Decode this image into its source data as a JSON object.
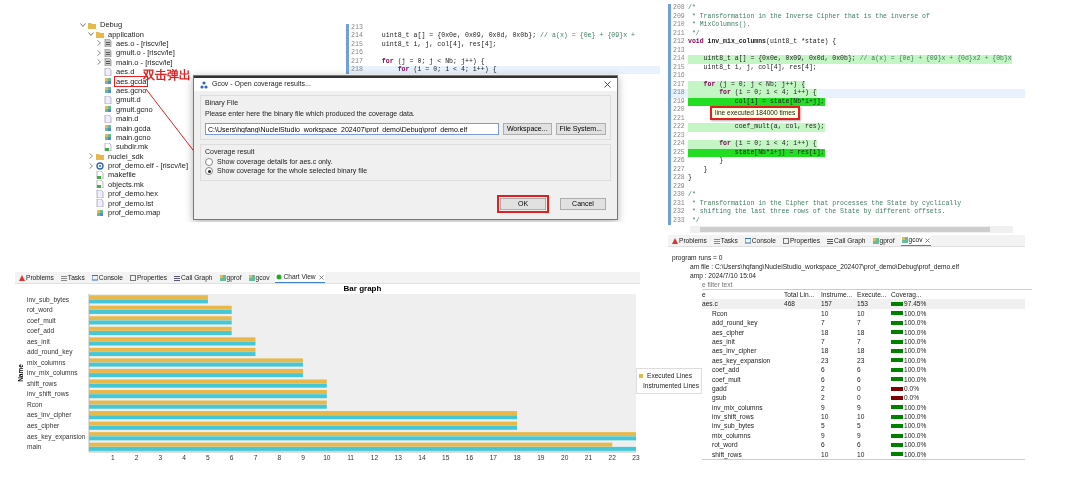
{
  "project_tree": {
    "items": [
      {
        "label": "Debug",
        "kind": "folder",
        "expanded": true,
        "highlighted": false,
        "children": [
          {
            "label": "application",
            "kind": "folder",
            "expanded": true,
            "highlighted": false,
            "children": [
              {
                "label": "aes.o - [riscv/le]",
                "kind": "object",
                "expanded": false,
                "highlighted": false
              },
              {
                "label": "gmult.o - [riscv/le]",
                "kind": "object",
                "expanded": false,
                "highlighted": false
              },
              {
                "label": "main.o - [riscv/le]",
                "kind": "object",
                "expanded": false,
                "highlighted": false
              },
              {
                "label": "aes.d",
                "kind": "file",
                "highlighted": false
              },
              {
                "label": "aes.gcda",
                "kind": "gcov",
                "highlighted": true
              },
              {
                "label": "aes.gcno",
                "kind": "gcov",
                "highlighted": false
              },
              {
                "label": "gmult.d",
                "kind": "file",
                "highlighted": false
              },
              {
                "label": "gmult.gcno",
                "kind": "gcov",
                "highlighted": false
              },
              {
                "label": "main.d",
                "kind": "file",
                "highlighted": false
              },
              {
                "label": "main.gcda",
                "kind": "gcov",
                "highlighted": false
              },
              {
                "label": "main.gcno",
                "kind": "gcov",
                "highlighted": false
              },
              {
                "label": "subdir.mk",
                "kind": "make",
                "highlighted": false
              }
            ]
          },
          {
            "label": "nuclei_sdk",
            "kind": "folder",
            "expanded": false,
            "highlighted": false
          },
          {
            "label": "prof_demo.elf - [riscv/le]",
            "kind": "elf",
            "expanded": false,
            "highlighted": false
          },
          {
            "label": "makefile",
            "kind": "make",
            "highlighted": false
          },
          {
            "label": "objects.mk",
            "kind": "make",
            "highlighted": false
          },
          {
            "label": "prof_demo.hex",
            "kind": "file",
            "highlighted": false
          },
          {
            "label": "prof_demo.lst",
            "kind": "file",
            "highlighted": false
          },
          {
            "label": "prof_demo.map",
            "kind": "gcov",
            "highlighted": false
          }
        ]
      }
    ]
  },
  "annotation": {
    "text": "双击弹出"
  },
  "back_editor": {
    "lines": [
      {
        "number": "213",
        "current": false
      },
      {
        "number": "214",
        "code": "    uint8_t a[] = {0x0e, 0x09, 0x0d, 0x0b}; // a(x) = {0e} + {09}x +",
        "kind": "code",
        "current": false
      },
      {
        "number": "215",
        "code": "    uint8_t i, j, col[4], res[4];",
        "kind": "code",
        "current": false
      },
      {
        "number": "216",
        "current": false
      },
      {
        "number": "217",
        "code": "    for (j = 0; j < Nb; j++) {",
        "kind": "code",
        "current": false
      },
      {
        "number": "218",
        "code": "        for (i = 0; i < 4; i++) {",
        "kind": "code",
        "current": true
      }
    ]
  },
  "dialog": {
    "title": "Gcov - Open coverage results...",
    "binary_group": {
      "title": "Binary File",
      "description": "Please enter here the binary file which produced the coverage data.",
      "value": "C:\\Users\\hqfang\\NucleiStudio_workspace_202407\\prof_demo\\Debug\\prof_demo.elf",
      "buttons": [
        "Workspace...",
        "File System..."
      ]
    },
    "result_group": {
      "title": "Coverage result",
      "options": [
        {
          "label": "Show coverage details for aes.c only.",
          "selected": false
        },
        {
          "label": "Show coverage for the whole selected binary file",
          "selected": true
        }
      ]
    },
    "buttons": [
      {
        "label": "OK",
        "highlighted": true
      },
      {
        "label": "Cancel",
        "highlighted": false
      }
    ]
  },
  "chart_view": {
    "tabs": [
      {
        "label": "Problems",
        "kind": "problems",
        "selected": false,
        "closable": false
      },
      {
        "label": "Tasks",
        "kind": "tasks",
        "selected": false,
        "closable": false
      },
      {
        "label": "Console",
        "kind": "console",
        "selected": false,
        "closable": false
      },
      {
        "label": "Properties",
        "kind": "properties",
        "selected": false,
        "closable": false
      },
      {
        "label": "Call Graph",
        "kind": "callgraph",
        "selected": false,
        "closable": false
      },
      {
        "label": "gprof",
        "kind": "gprof",
        "selected": false,
        "closable": false
      },
      {
        "label": "gcov",
        "kind": "gprof",
        "selected": false,
        "closable": false
      },
      {
        "label": "Chart View",
        "kind": "chart",
        "selected": true,
        "closable": true
      }
    ],
    "chart_data": {
      "type": "bar",
      "orientation": "horizontal",
      "title": "Bar graph",
      "ylabel": "Name",
      "categories": [
        "inv_sub_bytes",
        "rot_word",
        "coef_mult",
        "coef_add",
        "aes_init",
        "add_round_key",
        "mix_columns",
        "inv_mix_columns",
        "shift_rows",
        "inv_shift_rows",
        "Rcon",
        "aes_inv_cipher",
        "aes_cipher",
        "aes_key_expansion",
        "main"
      ],
      "series": [
        {
          "name": "Executed Lines",
          "color": "#e8b84a",
          "values": [
            5,
            6,
            6,
            6,
            7,
            7,
            9,
            9,
            10,
            10,
            10,
            18,
            18,
            23,
            22
          ]
        },
        {
          "name": "Instrumented Lines",
          "color": "#44c8d8",
          "values": [
            5,
            6,
            6,
            6,
            7,
            7,
            9,
            9,
            10,
            10,
            10,
            18,
            18,
            23,
            23
          ]
        }
      ],
      "xlim": [
        0,
        23
      ],
      "xticks": [
        1,
        2,
        3,
        4,
        5,
        6,
        7,
        8,
        9,
        10,
        11,
        12,
        13,
        14,
        15,
        16,
        17,
        18,
        19,
        20,
        21,
        22,
        23
      ]
    }
  },
  "code_editor": {
    "lines": [
      {
        "number": "208",
        "code": "/*",
        "kind": "comment",
        "current": false
      },
      {
        "number": "209",
        "code": " * Transformation in the Inverse Cipher that is the inverse of",
        "kind": "comment",
        "current": false
      },
      {
        "number": "210",
        "code": " * MixColumns().",
        "kind": "comment",
        "current": false
      },
      {
        "number": "211",
        "code": " */",
        "kind": "comment",
        "current": false
      },
      {
        "number": "212",
        "code": "void inv_mix_columns(uint8_t *state) {",
        "kind": "declaration",
        "current": false
      },
      {
        "number": "213",
        "current": false
      },
      {
        "number": "214",
        "code": "    uint8_t a[] = {0x0e, 0x09, 0x0d, 0x0b}; // a(x) = {0e} + {09}x + {0d}x2 + {0b}x",
        "kind": "code",
        "color": "#c4f5c4",
        "current": false
      },
      {
        "number": "215",
        "code": "    uint8_t i, j, col[4], res[4];",
        "kind": "code",
        "current": false
      },
      {
        "number": "216",
        "current": false
      },
      {
        "number": "217",
        "code": "    for (j = 0; j < Nb; j++) {",
        "kind": "code",
        "color": "#c4f5c4",
        "current": false
      },
      {
        "number": "218",
        "code": "        for (i = 0; i < 4; i++) {",
        "kind": "code",
        "color": "#c4f5c4",
        "current": true
      },
      {
        "number": "219",
        "code": "            col[i] = state[Nb*i+j];",
        "kind": "code",
        "color": "#22dd22",
        "current": false
      },
      {
        "number": "220",
        "current": false
      },
      {
        "number": "221",
        "current": false
      },
      {
        "number": "222",
        "code": "            coef_mult(a, col, res);",
        "kind": "code",
        "color": "#c4f5c4",
        "current": false
      },
      {
        "number": "223",
        "current": false
      },
      {
        "number": "224",
        "code": "        for (i = 0; i < 4; i++) {",
        "kind": "code",
        "color": "#c4f5c4",
        "current": false
      },
      {
        "number": "225",
        "code": "            state[Nb*i+j] = res[i];",
        "kind": "code",
        "color": "#22dd22",
        "current": false
      },
      {
        "number": "226",
        "code": "        }",
        "kind": "code",
        "current": false
      },
      {
        "number": "227",
        "code": "    }",
        "kind": "code",
        "current": false
      },
      {
        "number": "228",
        "code": "}",
        "kind": "code",
        "current": false
      },
      {
        "number": "229",
        "current": false
      },
      {
        "number": "230",
        "code": "/*",
        "kind": "comment",
        "current": false
      },
      {
        "number": "231",
        "code": " * Transformation in the Cipher that processes the State by cyclically",
        "kind": "comment",
        "current": false
      },
      {
        "number": "232",
        "code": " * shifting the last three rows of the State by different offsets.",
        "kind": "comment",
        "current": false
      },
      {
        "number": "233",
        "code": " */",
        "kind": "comment",
        "current": false
      }
    ],
    "tooltip": {
      "text": "line executed 184000 times",
      "highlighted": true
    }
  },
  "gcov_view": {
    "tabs": [
      {
        "label": "Problems",
        "kind": "problems",
        "selected": false,
        "closable": false
      },
      {
        "label": "Tasks",
        "kind": "tasks",
        "selected": false,
        "closable": false
      },
      {
        "label": "Console",
        "kind": "console",
        "selected": false,
        "closable": false
      },
      {
        "label": "Properties",
        "kind": "properties",
        "selected": false,
        "closable": false
      },
      {
        "label": "Call Graph",
        "kind": "callgraph",
        "selected": false,
        "closable": false
      },
      {
        "label": "gprof",
        "kind": "gprof",
        "selected": false,
        "closable": false
      },
      {
        "label": "gcov",
        "kind": "gprof",
        "selected": true,
        "closable": true
      }
    ],
    "program_runs": "program runs = 0",
    "program_file": "am file : C:\\Users\\hqfang\\NucleiStudio_workspace_202407\\prof_demo\\Debug\\prof_demo.elf",
    "timestamp": "amp : 2024/7/10 15:04",
    "filter": {
      "placeholder": "e filter text"
    },
    "columns": [
      "e",
      "Total Lin...",
      "Instrume...",
      "Execute...",
      "Coverag..."
    ],
    "rows": [
      {
        "name": "aes.c",
        "total_lines": "468",
        "instrumented": "157",
        "executed": "153",
        "coverage": "97.45%",
        "color": "#008000",
        "children": [
          {
            "name": "Rcon",
            "instrumented": "10",
            "executed": "10",
            "coverage": "100.0%",
            "color": "#008000"
          },
          {
            "name": "add_round_key",
            "instrumented": "7",
            "executed": "7",
            "coverage": "100.0%",
            "color": "#008000"
          },
          {
            "name": "aes_cipher",
            "instrumented": "18",
            "executed": "18",
            "coverage": "100.0%",
            "color": "#008000"
          },
          {
            "name": "aes_init",
            "instrumented": "7",
            "executed": "7",
            "coverage": "100.0%",
            "color": "#008000"
          },
          {
            "name": "aes_inv_cipher",
            "instrumented": "18",
            "executed": "18",
            "coverage": "100.0%",
            "color": "#008000"
          },
          {
            "name": "aes_key_expansion",
            "instrumented": "23",
            "executed": "23",
            "coverage": "100.0%",
            "color": "#008000"
          },
          {
            "name": "coef_add",
            "instrumented": "6",
            "executed": "6",
            "coverage": "100.0%",
            "color": "#008000"
          },
          {
            "name": "coef_mult",
            "instrumented": "6",
            "executed": "6",
            "coverage": "100.0%",
            "color": "#008000"
          },
          {
            "name": "gadd",
            "instrumented": "2",
            "executed": "0",
            "coverage": "0.0%",
            "color": "#800000"
          },
          {
            "name": "gsub",
            "instrumented": "2",
            "executed": "0",
            "coverage": "0.0%",
            "color": "#800000"
          },
          {
            "name": "inv_mix_columns",
            "instrumented": "9",
            "executed": "9",
            "coverage": "100.0%",
            "color": "#008000"
          },
          {
            "name": "inv_shift_rows",
            "instrumented": "10",
            "executed": "10",
            "coverage": "100.0%",
            "color": "#008000"
          },
          {
            "name": "inv_sub_bytes",
            "instrumented": "5",
            "executed": "5",
            "coverage": "100.0%",
            "color": "#008000"
          },
          {
            "name": "mix_columns",
            "instrumented": "9",
            "executed": "9",
            "coverage": "100.0%",
            "color": "#008000"
          },
          {
            "name": "rot_word",
            "instrumented": "6",
            "executed": "6",
            "coverage": "100.0%",
            "color": "#008000"
          },
          {
            "name": "shift_rows",
            "instrumented": "10",
            "executed": "10",
            "coverage": "100.0%",
            "color": "#008000"
          }
        ]
      }
    ]
  }
}
